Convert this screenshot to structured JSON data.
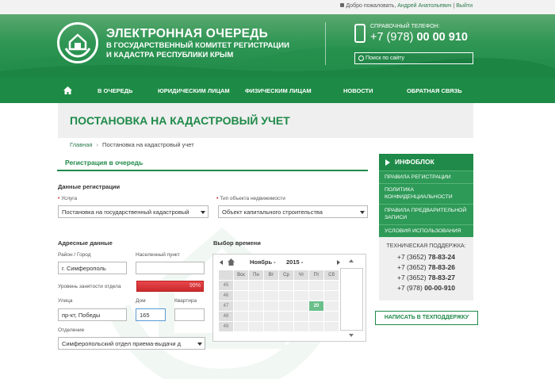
{
  "top_bar": {
    "welcome": "Добро пожаловать,",
    "user": "Андрей Анатольевич",
    "logout": "Выйти"
  },
  "brand": {
    "title": "ЭЛЕКТРОННАЯ ОЧЕРЕДЬ",
    "subtitle_1": "В ГОСУДАРСТВЕННЫЙ КОМИТЕТ РЕГИСТРАЦИИ",
    "subtitle_2": "И КАДАСТРА РЕСПУБЛИКИ КРЫМ"
  },
  "phone": {
    "label": "СПРАВОЧНЫЙ ТЕЛЕФОН:",
    "prefix": "+7 (978)",
    "number": "00 00 910"
  },
  "search": {
    "placeholder": "Поиск по сайту"
  },
  "nav": {
    "items": [
      "В ОЧЕРЕДЬ",
      "ЮРИДИЧЕСКИМ ЛИЦАМ",
      "ФИЗИЧЕСКИМ ЛИЦАМ",
      "НОВОСТИ",
      "ОБРАТНАЯ СВЯЗЬ"
    ]
  },
  "page": {
    "title": "ПОСТАНОВКА НА КАДАСТРОВЫЙ УЧЕТ",
    "breadcrumb_home": "Главная",
    "breadcrumb_sep": "›",
    "breadcrumb_current": "Постановка на кадастровый учет"
  },
  "form": {
    "section": "Регистрация в очередь",
    "reg_title": "Данные регистрации",
    "service_label": "Услуга",
    "service_value": "Постановка на государственный кадастровый",
    "object_label": "Тип объекта недвижимости",
    "object_value": "Объект капитального строительства",
    "address_title": "Адресные данные",
    "district_label": "Район / Город",
    "district_value": "г. Симферополь",
    "locality_label": "Населенный пункт",
    "locality_value": "",
    "load_label": "Уровень занятости отдела",
    "load_value": "99%",
    "load_fraction": 0.99,
    "street_label": "Улица",
    "street_value": "пр-кт, Победы",
    "house_label": "Дом",
    "house_value": "165",
    "apt_label": "Квартира",
    "apt_value": "",
    "dept_label": "Отделение",
    "dept_value": "Симферопольский отдел приема-выдачи д",
    "time_title": "Выбор времени"
  },
  "calendar": {
    "month": "Ноябрь -",
    "year": "2015 -",
    "days": [
      "Пн",
      "Вт",
      "Ср",
      "Чт",
      "Пт",
      "Сб"
    ],
    "week_header": "Вск",
    "weeks": [
      "45",
      "46",
      "47",
      "48",
      "49"
    ],
    "selected_day": "20"
  },
  "sidebar": {
    "title": "ИНФОБЛОК",
    "links": [
      "ПРАВИЛА РЕГИСТРАЦИИ",
      "ПОЛИТИКА КОНФИДЕНЦИАЛЬНОСТИ",
      "ПРАВИЛА ПРЕДВАРИТЕЛЬНОЙ ЗАПИСИ",
      "УСЛОВИЯ ИСПОЛЬЗОВАНИЯ"
    ],
    "support_title": "ТЕХНИЧЕСКАЯ ПОДДЕРЖКА:",
    "support_lines": [
      {
        "prefix": "+7 (3652)",
        "number": "78-83-24"
      },
      {
        "prefix": "+7 (3652)",
        "number": "78-83-26"
      },
      {
        "prefix": "+7 (3652)",
        "number": "78-83-27"
      },
      {
        "prefix": "+7 (978)",
        "number": "00-00-910"
      }
    ],
    "support_button": "НАПИСАТЬ В ТЕХПОДДЕРЖКУ"
  },
  "colors": {
    "primary": "#1f8a49",
    "accent_red": "#d9383c",
    "selected_day": "#6bbf8a"
  }
}
